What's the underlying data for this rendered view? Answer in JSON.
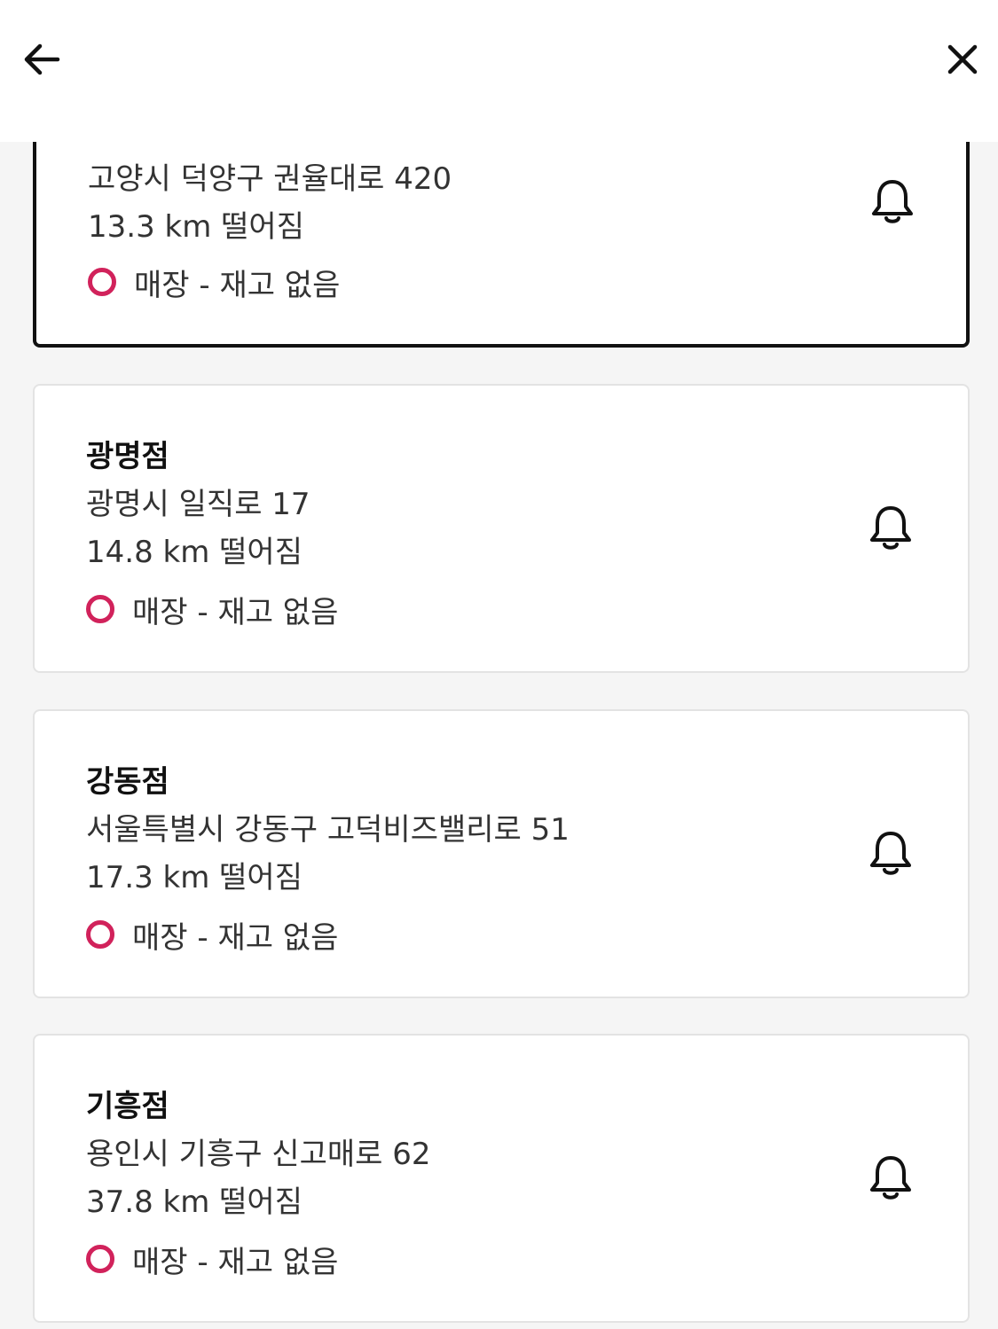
{
  "header": {
    "back_icon": "arrow-left-icon",
    "close_icon": "close-icon"
  },
  "accent_color": "#d1225b",
  "stores": [
    {
      "name": "",
      "address": "고양시 덕양구 권율대로 420",
      "distance": "13.3 km 떨어짐",
      "stock": "매장 - 재고 없음",
      "selected": true
    },
    {
      "name": "광명점",
      "address": "광명시 일직로 17",
      "distance": "14.8 km 떨어짐",
      "stock": "매장 - 재고 없음",
      "selected": false
    },
    {
      "name": "강동점",
      "address": "서울특별시 강동구 고덕비즈밸리로 51",
      "distance": "17.3 km 떨어짐",
      "stock": "매장 - 재고 없음",
      "selected": false
    },
    {
      "name": "기흥점",
      "address": "용인시 기흥구 신고매로 62",
      "distance": "37.8 km 떨어짐",
      "stock": "매장 - 재고 없음",
      "selected": false
    }
  ]
}
